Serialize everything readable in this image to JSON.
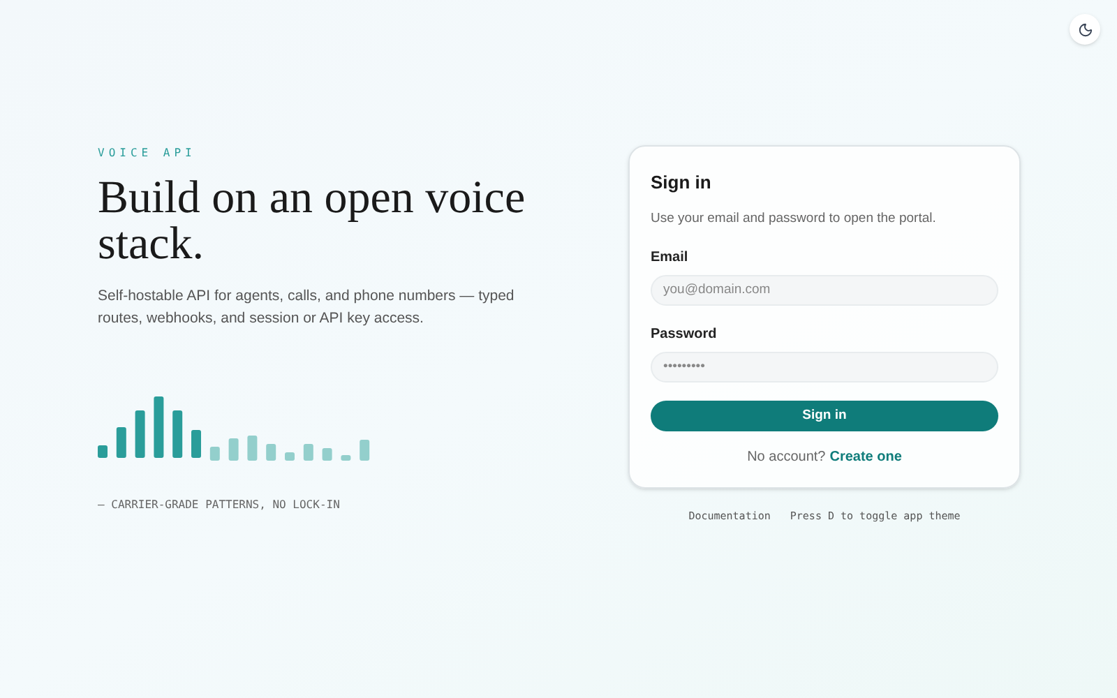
{
  "hero": {
    "eyebrow": "VOICE API",
    "title": "Build on an open voice stack.",
    "subtitle": "Self-hostable API for agents, calls, and phone numbers — typed routes, webhooks, and session or API key access.",
    "tagline": "— CARRIER-GRADE PATTERNS, NO LOCK-IN"
  },
  "card": {
    "title": "Sign in",
    "description": "Use your email and password to open the portal.",
    "fields": [
      {
        "label": "Email",
        "placeholder": "you@domain.com"
      },
      {
        "label": "Password",
        "placeholder": "•••••••••"
      }
    ],
    "submit": "Sign in",
    "signup_prompt": "No account?",
    "signup_link": "Create one"
  },
  "footer": {
    "link": "Documentation",
    "hint": "Press D to toggle app theme"
  }
}
